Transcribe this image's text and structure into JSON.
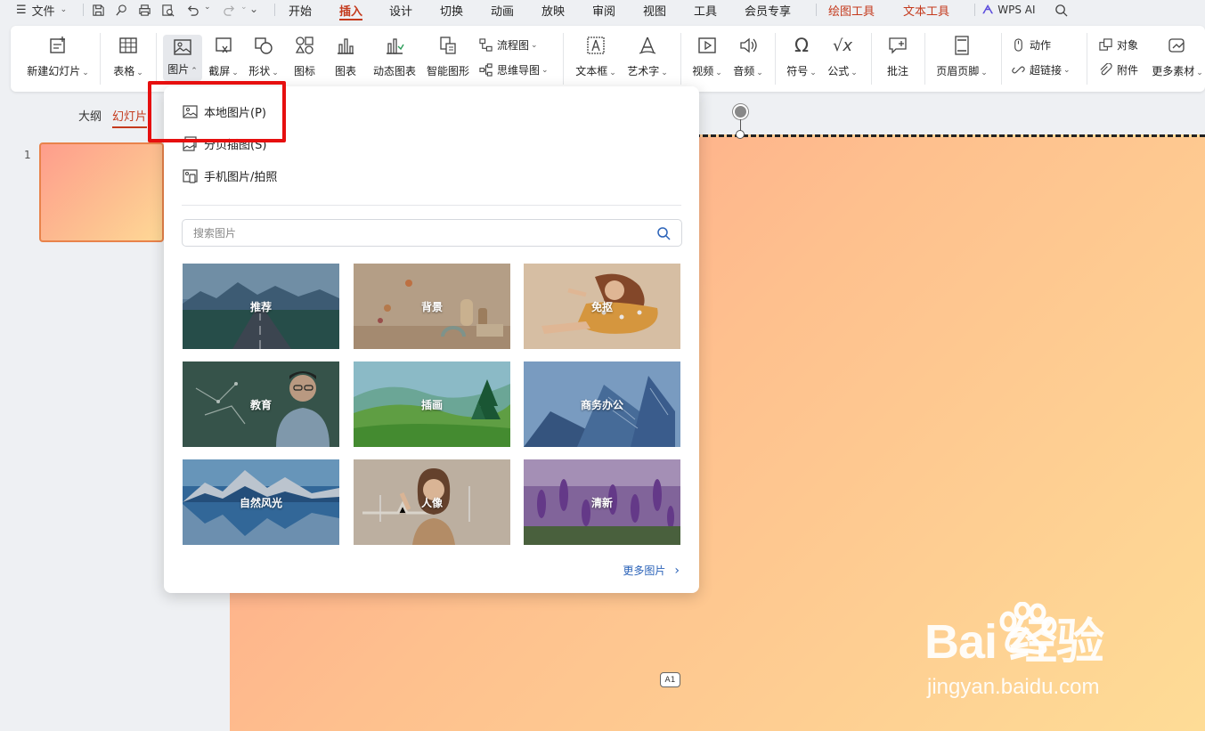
{
  "menubar": {
    "file_label": "文件",
    "tabs": [
      "开始",
      "插入",
      "设计",
      "切换",
      "动画",
      "放映",
      "审阅",
      "视图",
      "工具",
      "会员专享"
    ],
    "context_tabs": [
      "绘图工具",
      "文本工具"
    ],
    "wps_ai": "WPS AI",
    "active_tab": "插入"
  },
  "ribbon": {
    "new_slide": "新建幻灯片",
    "table": "表格",
    "picture": "图片",
    "screenshot": "截屏",
    "shape": "形状",
    "icon": "图标",
    "chart": "图表",
    "dynamic_chart": "动态图表",
    "smart_graphic": "智能图形",
    "flowchart": "流程图",
    "mindmap": "思维导图",
    "textbox": "文本框",
    "wordart": "艺术字",
    "video": "视频",
    "audio": "音频",
    "symbol": "符号",
    "formula": "公式",
    "comment": "批注",
    "header_footer": "页眉页脚",
    "action": "动作",
    "hyperlink": "超链接",
    "object": "对象",
    "attachment": "附件",
    "more_materials": "更多素材"
  },
  "sidebar": {
    "tabs": [
      "大纲",
      "幻灯片"
    ],
    "active_tab": "幻灯片",
    "slide_number": "1"
  },
  "dropdown": {
    "items": [
      "本地图片(P)",
      "分页插图(S)",
      "手机图片/拍照"
    ],
    "search_placeholder": "搜索图片",
    "tiles": [
      "推荐",
      "背景",
      "免抠",
      "教育",
      "插画",
      "商务办公",
      "自然风光",
      "人像",
      "清新"
    ],
    "more_label": "更多图片"
  },
  "canvas": {
    "ai_badge": "A1"
  },
  "watermark": {
    "main": "Bai  经验",
    "url": "jingyan.baidu.com"
  },
  "colors": {
    "accent": "#c43a1d",
    "highlight_box": "#e60f0f",
    "link": "#2a62b8"
  }
}
